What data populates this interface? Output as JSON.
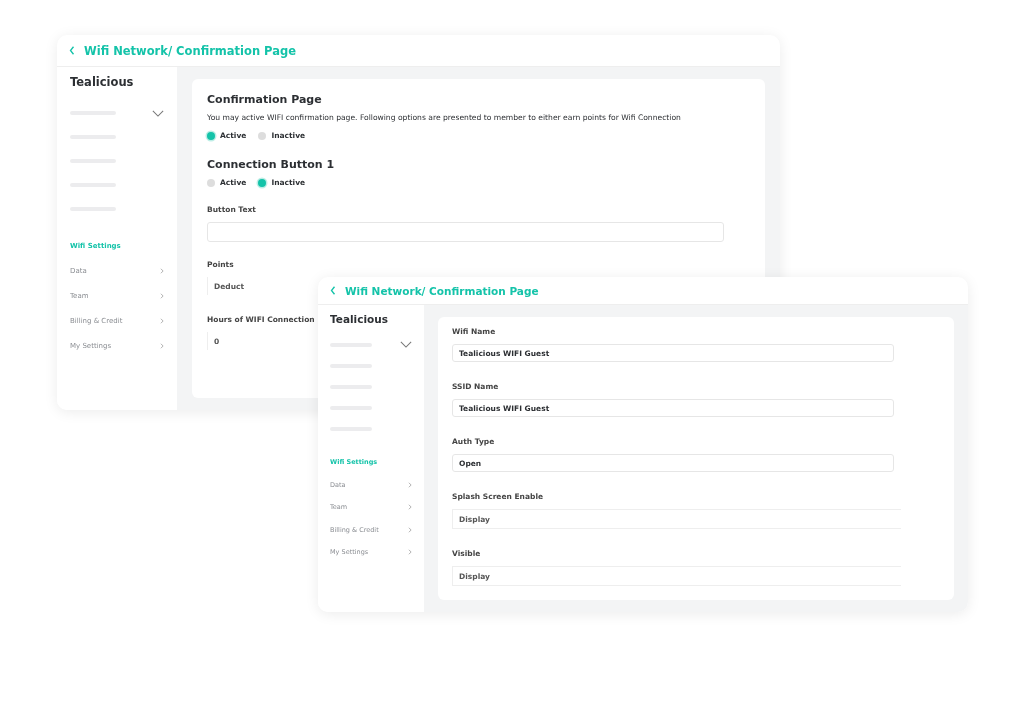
{
  "windows": [
    {
      "title": "Wifi Network/ Confirmation Page",
      "sidebar": {
        "brand": "Tealicious",
        "nav": [
          {
            "label": "Wifi Settings",
            "selected": true,
            "expandable": false
          },
          {
            "label": "Data",
            "selected": false,
            "expandable": true
          },
          {
            "label": "Team",
            "selected": false,
            "expandable": true
          },
          {
            "label": "Billing & Credit",
            "selected": false,
            "expandable": true
          },
          {
            "label": "My Settings",
            "selected": false,
            "expandable": true
          }
        ]
      },
      "sections": [
        {
          "heading": "Confirmation Page",
          "description": "You may active WIFI confirmation page. Following options are presented to member to either earn points for Wifi Connection",
          "options": [
            {
              "label": "Active",
              "selected": true
            },
            {
              "label": "Inactive",
              "selected": false
            }
          ]
        },
        {
          "heading": "Connection Button 1",
          "options": [
            {
              "label": "Active",
              "selected": false
            },
            {
              "label": "Inactive",
              "selected": true
            }
          ]
        }
      ],
      "fields": [
        {
          "label": "Button Text",
          "kind": "input"
        },
        {
          "label": "Points",
          "value": "Deduct",
          "kind": "plain"
        },
        {
          "label": "Hours of WIFI Connection",
          "value": "0",
          "kind": "plain"
        }
      ]
    },
    {
      "title": "Wifi Network/ Confirmation Page",
      "sidebar": {
        "brand": "Tealicious",
        "nav": [
          {
            "label": "Wifi Settings",
            "selected": true,
            "expandable": false
          },
          {
            "label": "Data",
            "selected": false,
            "expandable": true
          },
          {
            "label": "Team",
            "selected": false,
            "expandable": true
          },
          {
            "label": "Billing & Credit",
            "selected": false,
            "expandable": true
          },
          {
            "label": "My Settings",
            "selected": false,
            "expandable": true
          }
        ]
      },
      "fields": [
        {
          "label": "Wifi Name",
          "value": "Tealicious WIFI Guest",
          "kind": "input"
        },
        {
          "label": "SSID Name",
          "value": "Tealicious WIFI Guest",
          "kind": "input"
        },
        {
          "label": "Auth Type",
          "value": "Open",
          "kind": "input"
        },
        {
          "label": "Splash Screen Enable",
          "value": "Display",
          "kind": "plain"
        },
        {
          "label": "Visible",
          "value": "Display",
          "kind": "plain"
        }
      ]
    }
  ]
}
